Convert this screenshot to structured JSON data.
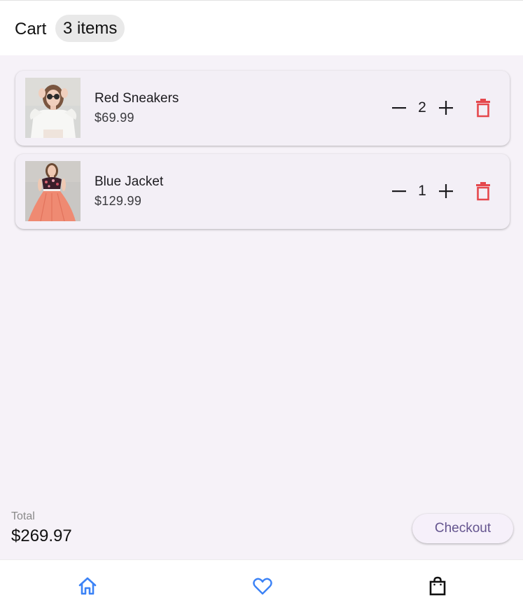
{
  "app_bar": {
    "title": "Cart",
    "count_badge": "3 items"
  },
  "cart": {
    "items": [
      {
        "name": "Red Sneakers",
        "price": "$69.99",
        "quantity": "2",
        "thumbnail": "woman-white-top-sunglasses-photo"
      },
      {
        "name": "Blue Jacket",
        "price": "$129.99",
        "quantity": "1",
        "thumbnail": "woman-floral-top-coral-skirt-photo"
      }
    ]
  },
  "summary": {
    "total_label": "Total",
    "total_value": "$269.97",
    "checkout_label": "Checkout"
  },
  "bottom_nav": {
    "items": [
      {
        "icon": "home-icon",
        "active": true
      },
      {
        "icon": "heart-icon",
        "active": true
      },
      {
        "icon": "shopping-bag-icon",
        "active": false
      }
    ]
  },
  "colors": {
    "background": "#f6f2f8",
    "card": "#f3eff6",
    "delete": "#e5484d",
    "nav_active": "#3b82f6",
    "checkout_text": "#65558f"
  },
  "icons": {
    "quantity_decrease": "minus-icon",
    "quantity_increase": "plus-icon",
    "remove_item": "trash-icon"
  }
}
